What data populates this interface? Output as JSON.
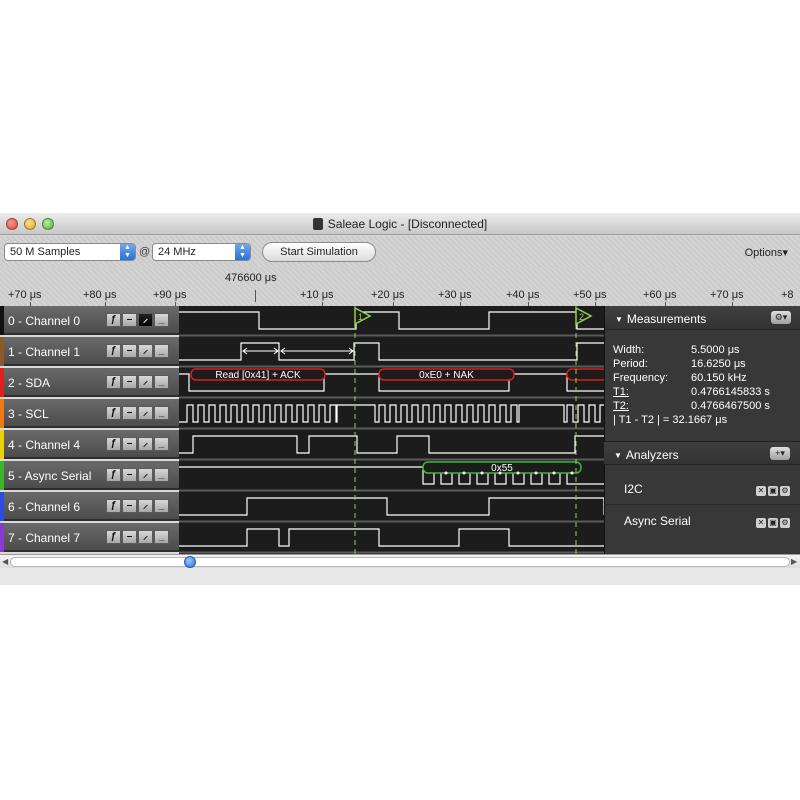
{
  "window": {
    "title": "Saleae Logic  - [Disconnected]"
  },
  "toolbar": {
    "samples_value": "50 M Samples",
    "at_symbol": "@",
    "rate_value": "24 MHz",
    "start_button": "Start Simulation",
    "options_label": "Options▾"
  },
  "ruler": {
    "center_time": "476600 μs",
    "ticks": [
      "+70 μs",
      "+80 μs",
      "+90 μs",
      "+10 μs",
      "+20 μs",
      "+30 μs",
      "+40 μs",
      "+50 μs",
      "+60 μs",
      "+70 μs",
      "+8"
    ]
  },
  "channels": [
    {
      "label": "0 - Channel 0",
      "color": "#111111"
    },
    {
      "label": "1 - Channel 1",
      "color": "#8a5a2b"
    },
    {
      "label": "2 - SDA",
      "color": "#e02020"
    },
    {
      "label": "3 - SCL",
      "color": "#f07a10"
    },
    {
      "label": "4 - Channel 4",
      "color": "#e8d20e"
    },
    {
      "label": "5 - Async Serial",
      "color": "#3db52a"
    },
    {
      "label": "6 - Channel 6",
      "color": "#2a4de0"
    },
    {
      "label": "7 - Channel 7",
      "color": "#8a3ad0"
    }
  ],
  "trigger_glyphs": [
    "ƒ",
    "–",
    "⸝",
    "_"
  ],
  "waveform": {
    "annotations": [
      {
        "text": "Read [0x41] + ACK",
        "color": "#d42020"
      },
      {
        "text": "0xE0 + NAK",
        "color": "#d42020"
      },
      {
        "text": "0x55",
        "color": "#3fb53a"
      }
    ],
    "marker_1": "1",
    "marker_2": "2"
  },
  "measurements": {
    "header": "Measurements",
    "rows": [
      {
        "key": "Width:",
        "value": "5.5000 μs"
      },
      {
        "key": "Period:",
        "value": "16.6250 μs"
      },
      {
        "key": "Frequency:",
        "value": "60.150 kHz"
      },
      {
        "key": "T1:",
        "value": "0.4766145833 s"
      },
      {
        "key": "T2:",
        "value": "0.4766467500 s"
      }
    ],
    "diff": "| T1 - T2 | = 32.1667 μs"
  },
  "analyzers": {
    "header": "Analyzers",
    "add_button": "+▾",
    "items": [
      "I2C",
      "Async Serial"
    ]
  },
  "colors": {
    "marker_green": "#8fd14f",
    "waveform_bg": "#1e1e1e",
    "trace": "#ffffff"
  }
}
